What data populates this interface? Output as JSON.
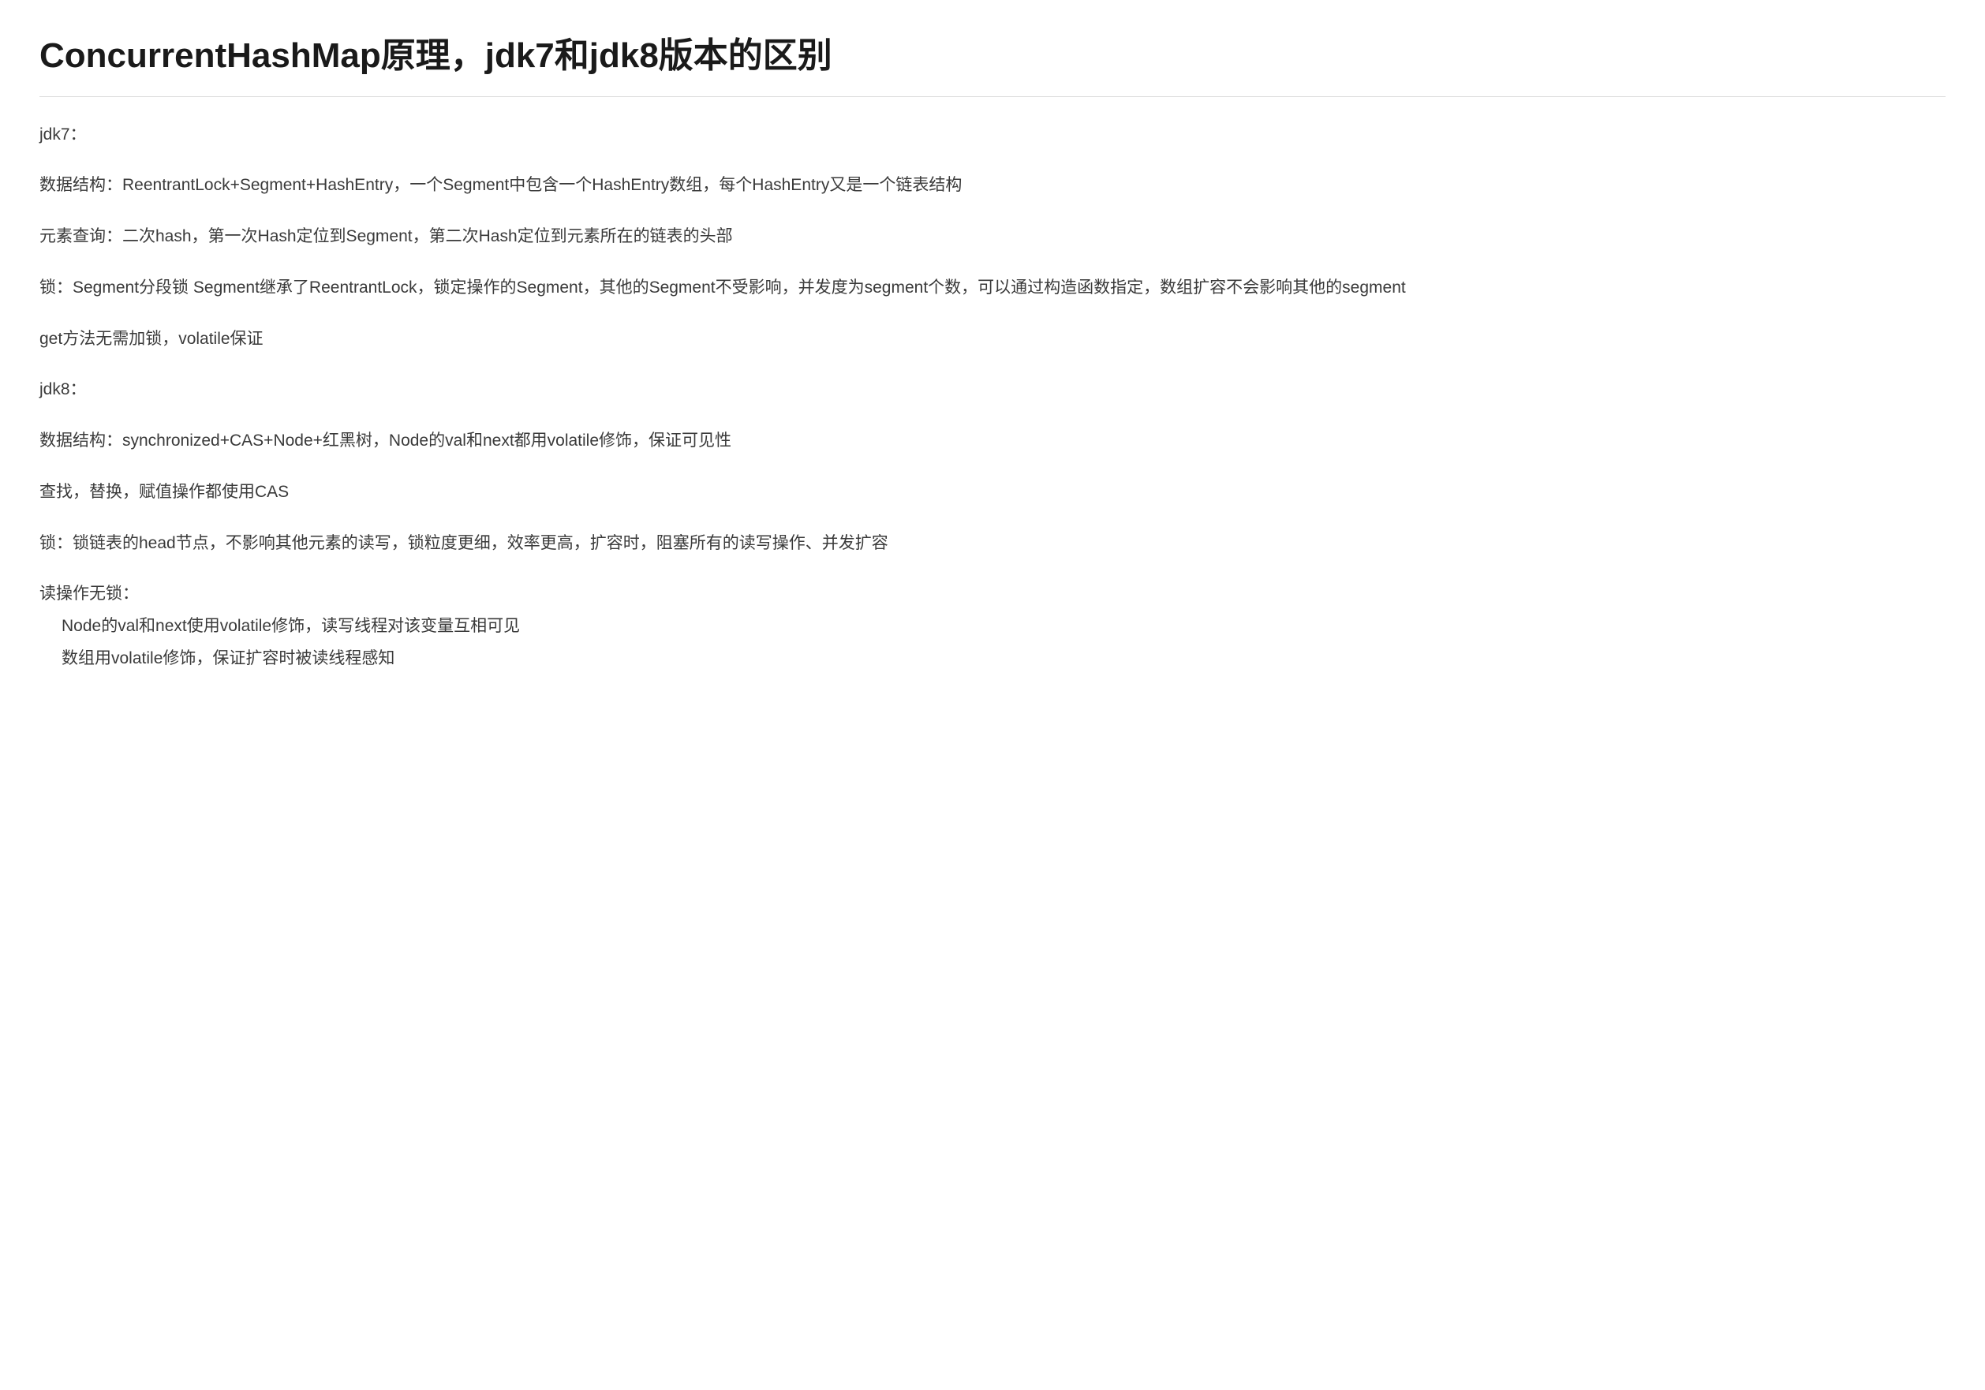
{
  "title": "ConcurrentHashMap原理，jdk7和jdk8版本的区别",
  "paragraphs": {
    "p1": "jdk7：",
    "p2": "数据结构：ReentrantLock+Segment+HashEntry，一个Segment中包含一个HashEntry数组，每个HashEntry又是一个链表结构",
    "p3": "元素查询：二次hash，第一次Hash定位到Segment，第二次Hash定位到元素所在的链表的头部",
    "p4": "锁：Segment分段锁 Segment继承了ReentrantLock，锁定操作的Segment，其他的Segment不受影响，并发度为segment个数，可以通过构造函数指定，数组扩容不会影响其他的segment",
    "p5": "get方法无需加锁，volatile保证",
    "p6": "jdk8：",
    "p7": "数据结构：synchronized+CAS+Node+红黑树，Node的val和next都用volatile修饰，保证可见性",
    "p8": "查找，替换，赋值操作都使用CAS",
    "p9": "锁：锁链表的head节点，不影响其他元素的读写，锁粒度更细，效率更高，扩容时，阻塞所有的读写操作、并发扩容",
    "p10": "读操作无锁：",
    "p11": "Node的val和next使用volatile修饰，读写线程对该变量互相可见",
    "p12": "数组用volatile修饰，保证扩容时被读线程感知"
  }
}
